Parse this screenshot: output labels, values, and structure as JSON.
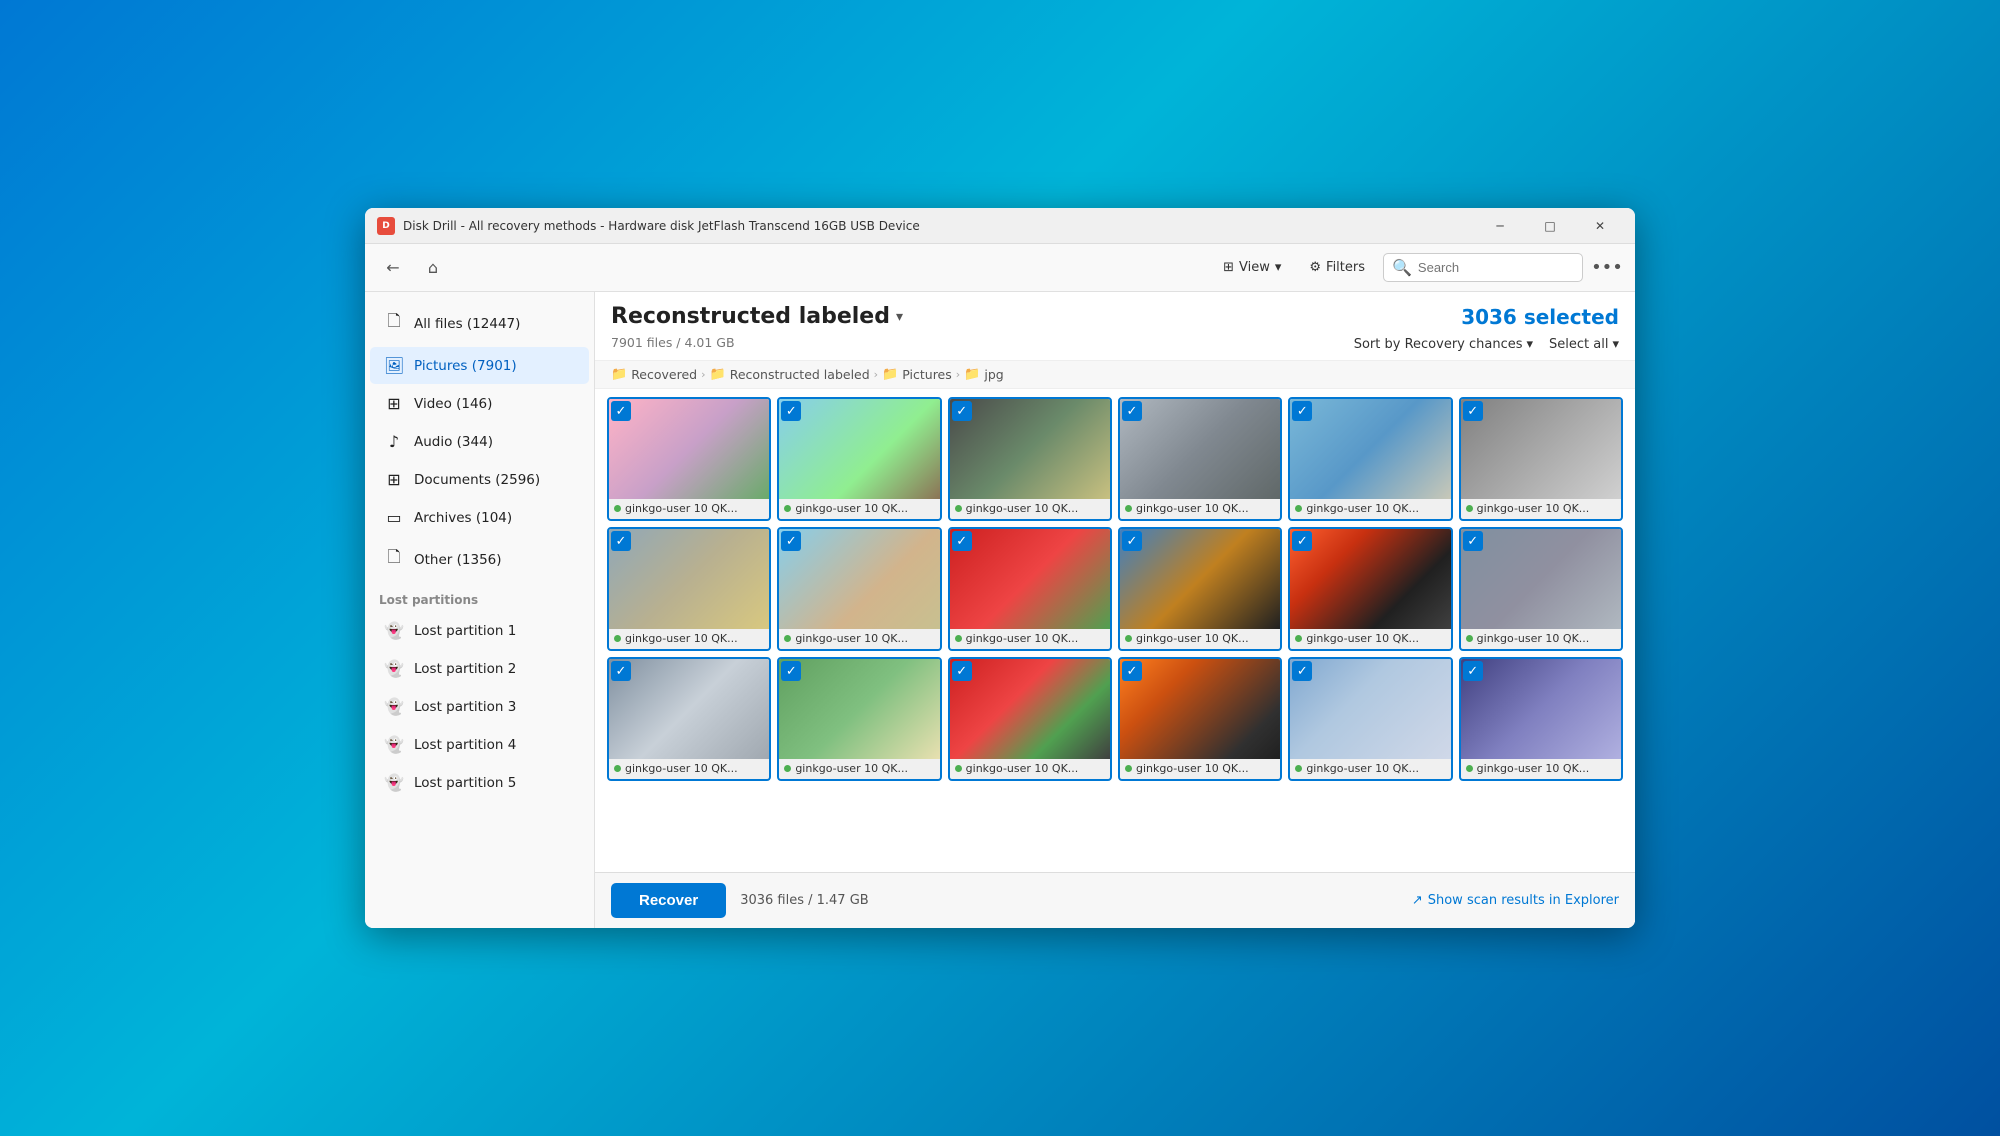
{
  "window": {
    "title": "Disk Drill - All recovery methods - Hardware disk JetFlash Transcend 16GB USB Device",
    "icon_label": "D"
  },
  "titlebar_controls": {
    "minimize": "─",
    "maximize": "□",
    "close": "✕"
  },
  "toolbar": {
    "back_label": "←",
    "home_label": "⌂",
    "view_label": "View",
    "filters_label": "Filters",
    "search_placeholder": "Search",
    "more_label": "•••"
  },
  "sidebar": {
    "items": [
      {
        "id": "all-files",
        "icon": "🗋",
        "label": "All files (12447)"
      },
      {
        "id": "pictures",
        "icon": "🖼",
        "label": "Pictures (7901)"
      },
      {
        "id": "video",
        "icon": "⊞",
        "label": "Video (146)"
      },
      {
        "id": "audio",
        "icon": "♪",
        "label": "Audio (344)"
      },
      {
        "id": "documents",
        "icon": "⊞",
        "label": "Documents (2596)"
      },
      {
        "id": "archives",
        "icon": "▭",
        "label": "Archives (104)"
      },
      {
        "id": "other",
        "icon": "🗋",
        "label": "Other (1356)"
      }
    ],
    "section_label": "Lost partitions",
    "partitions": [
      {
        "id": "lp1",
        "label": "Lost partition 1"
      },
      {
        "id": "lp2",
        "label": "Lost partition 2"
      },
      {
        "id": "lp3",
        "label": "Lost partition 3"
      },
      {
        "id": "lp4",
        "label": "Lost partition 4"
      },
      {
        "id": "lp5",
        "label": "Lost partition 5"
      }
    ]
  },
  "content": {
    "title": "Reconstructed labeled",
    "selected_count": "3036 selected",
    "meta": "7901 files / 4.01 GB",
    "sort_label": "Sort by Recovery chances",
    "select_all_label": "Select all"
  },
  "breadcrumb": {
    "items": [
      {
        "icon": "📁",
        "label": "Recovered"
      },
      {
        "icon": "📁",
        "label": "Reconstructed labeled"
      },
      {
        "icon": "📁",
        "label": "Pictures"
      },
      {
        "icon": "📁",
        "label": "jpg"
      }
    ]
  },
  "grid_items": [
    {
      "id": 1,
      "label": "ginkgo-user 10 QK...",
      "img_class": "img-pink",
      "selected": true
    },
    {
      "id": 2,
      "label": "ginkgo-user 10 QK...",
      "img_class": "img-nature",
      "selected": true
    },
    {
      "id": 3,
      "label": "ginkgo-user 10 QK...",
      "img_class": "img-dark",
      "selected": true
    },
    {
      "id": 4,
      "label": "ginkgo-user 10 QK...",
      "img_class": "img-gray",
      "selected": true
    },
    {
      "id": 5,
      "label": "ginkgo-user 10 QK...",
      "img_class": "img-water",
      "selected": true
    },
    {
      "id": 6,
      "label": "ginkgo-user 10 QK...",
      "img_class": "img-road",
      "selected": true
    },
    {
      "id": 7,
      "label": "ginkgo-user 10 QK...",
      "img_class": "img-shore",
      "selected": true
    },
    {
      "id": 8,
      "label": "ginkgo-user 10 QK...",
      "img_class": "img-beach",
      "selected": true
    },
    {
      "id": 9,
      "label": "ginkgo-user 10 QK...",
      "img_class": "img-red",
      "selected": true
    },
    {
      "id": 10,
      "label": "ginkgo-user 10 QK...",
      "img_class": "img-sunset",
      "selected": true
    },
    {
      "id": 11,
      "label": "ginkgo-user 10 QK...",
      "img_class": "img-sunset2",
      "selected": true
    },
    {
      "id": 12,
      "label": "ginkgo-user 10 QK...",
      "img_class": "img-road2",
      "selected": true
    },
    {
      "id": 13,
      "label": "ginkgo-user 10 QK...",
      "img_class": "img-poles",
      "selected": true
    },
    {
      "id": 14,
      "label": "ginkgo-user 10 QK...",
      "img_class": "img-field",
      "selected": true
    },
    {
      "id": 15,
      "label": "ginkgo-user 10 QK...",
      "img_class": "img-poppy",
      "selected": true
    },
    {
      "id": 16,
      "label": "ginkgo-user 10 QK...",
      "img_class": "img-sunset3",
      "selected": true
    },
    {
      "id": 17,
      "label": "ginkgo-user 10 QK...",
      "img_class": "img-cloud",
      "selected": true
    },
    {
      "id": 18,
      "label": "ginkgo-user 10 QK...",
      "img_class": "img-frosty",
      "selected": true
    }
  ],
  "bottom_bar": {
    "recover_label": "Recover",
    "info": "3036 files / 1.47 GB",
    "show_explorer_label": "Show scan results in Explorer"
  }
}
